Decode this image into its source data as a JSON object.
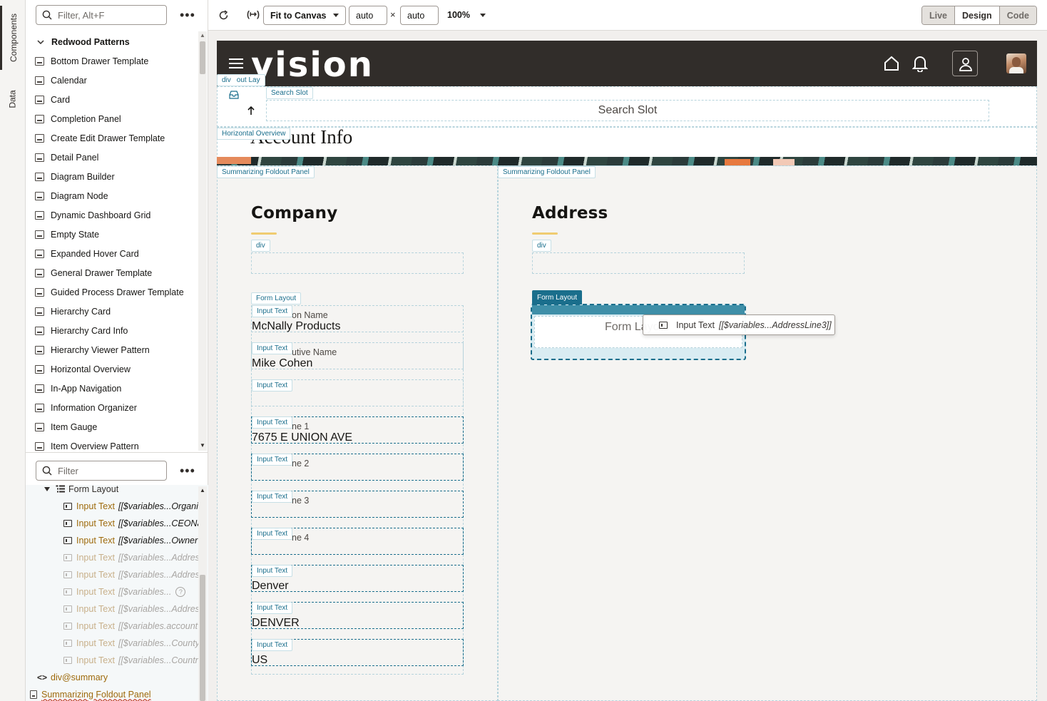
{
  "vtabs": {
    "components": "Components",
    "data": "Data"
  },
  "components": {
    "filter_placeholder": "Filter, Alt+F",
    "group": "Redwood Patterns",
    "items": [
      "Bottom Drawer Template",
      "Calendar",
      "Card",
      "Completion Panel",
      "Create Edit Drawer Template",
      "Detail Panel",
      "Diagram Builder",
      "Diagram Node",
      "Dynamic Dashboard Grid",
      "Empty State",
      "Expanded Hover Card",
      "General Drawer Template",
      "Guided Process Drawer Template",
      "Hierarchy Card",
      "Hierarchy Card Info",
      "Hierarchy Viewer Pattern",
      "Horizontal Overview",
      "In-App Navigation",
      "Information Organizer",
      "Item Gauge",
      "Item Overview Pattern"
    ]
  },
  "structure": {
    "filter_placeholder": "Filter",
    "root": "Form Layout",
    "rows": [
      {
        "tag": "Input Text",
        "expr": "[[$variables...Organi"
      },
      {
        "tag": "Input Text",
        "expr": "[[$variables...CEONa"
      },
      {
        "tag": "Input Text",
        "expr": "[[$variables...Owner"
      },
      {
        "tag": "Input Text",
        "expr": "[[$variables...Addres"
      },
      {
        "tag": "Input Text",
        "expr": "[[$variables...Addres"
      },
      {
        "tag": "Input Text",
        "expr": "[[$variables..."
      },
      {
        "tag": "Input Text",
        "expr": "[[$variables...Addres"
      },
      {
        "tag": "Input Text",
        "expr": "[[$variables.account"
      },
      {
        "tag": "Input Text",
        "expr": "[[$variables...County"
      },
      {
        "tag": "Input Text",
        "expr": "[[$variables...Countr"
      }
    ],
    "div_summary": "div@summary",
    "summarizing": "Summarizing Foldout Panel"
  },
  "toolbar": {
    "fit": "Fit to Canvas",
    "width": "auto",
    "times": "×",
    "height": "auto",
    "zoom": "100%",
    "modes": [
      "Live",
      "Design",
      "Code"
    ]
  },
  "canvas": {
    "logo": "vision",
    "labels": {
      "div": "div",
      "layout": "out Lay",
      "search_slot_tag": "Search Slot",
      "horizontal_overview": "Horizontal Overview",
      "summarizing": "Summarizing Foldout Panel",
      "form_layout": "Form Layout",
      "input_text": "Input Text"
    },
    "search_slot": "Search Slot",
    "account_title": "Account Info",
    "company": {
      "title": "Company",
      "fields": [
        {
          "label": "on Name",
          "value": "McNally Products"
        },
        {
          "label": "utive Name",
          "value": "Mike Cohen"
        },
        {
          "label": "",
          "value": ""
        },
        {
          "label": "ne 1",
          "value": "7675 E UNION AVE"
        },
        {
          "label": "ne 2",
          "value": ""
        },
        {
          "label": "ne 3",
          "value": ""
        },
        {
          "label": "ne 4",
          "value": ""
        },
        {
          "label": "",
          "value": "Denver"
        },
        {
          "label": "",
          "value": "DENVER"
        },
        {
          "label": "",
          "value": "US"
        }
      ]
    },
    "address": {
      "title": "Address",
      "form_placeholder": "Form Layout",
      "drag_tag": "Input Text",
      "drag_expr": "[[$variables...AddressLine3]]"
    }
  }
}
